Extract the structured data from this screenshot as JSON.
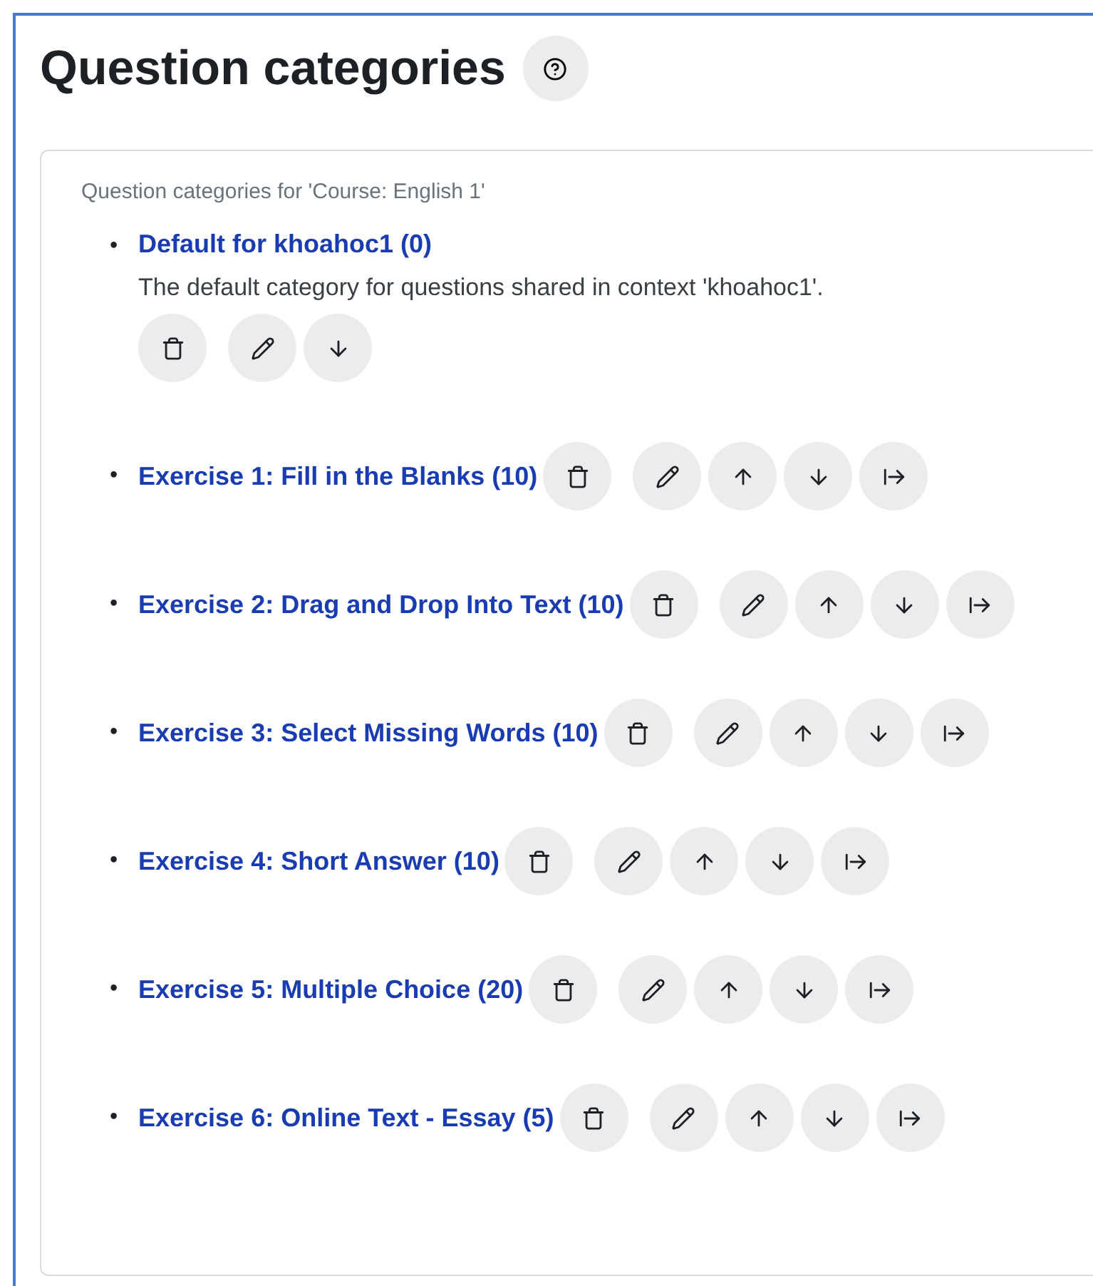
{
  "page": {
    "title": "Question categories"
  },
  "card": {
    "caption": "Question categories for 'Course: English 1'",
    "categories": [
      {
        "bullet": "•",
        "name": "Default for khoahoc1 (0)",
        "description": "The default category for questions shared in context 'khoahoc1'.",
        "actions": [
          {
            "kind": "delete"
          },
          {
            "kind": "edit"
          },
          {
            "kind": "down"
          }
        ]
      },
      {
        "bullet": "•",
        "name": "Exercise 1: Fill in the Blanks (10)",
        "actions": [
          {
            "kind": "delete"
          },
          {
            "kind": "edit"
          },
          {
            "kind": "up"
          },
          {
            "kind": "down"
          },
          {
            "kind": "move"
          }
        ]
      },
      {
        "bullet": "•",
        "name": "Exercise 2: Drag and Drop Into Text (10)",
        "actions": [
          {
            "kind": "delete"
          },
          {
            "kind": "edit"
          },
          {
            "kind": "up"
          },
          {
            "kind": "down"
          },
          {
            "kind": "move"
          }
        ]
      },
      {
        "bullet": "•",
        "name": "Exercise 3: Select Missing Words (10)",
        "actions": [
          {
            "kind": "delete"
          },
          {
            "kind": "edit"
          },
          {
            "kind": "up"
          },
          {
            "kind": "down"
          },
          {
            "kind": "move"
          }
        ]
      },
      {
        "bullet": "•",
        "name": "Exercise 4: Short Answer (10)",
        "actions": [
          {
            "kind": "delete"
          },
          {
            "kind": "edit"
          },
          {
            "kind": "up"
          },
          {
            "kind": "down"
          },
          {
            "kind": "move"
          }
        ]
      },
      {
        "bullet": "•",
        "name": "Exercise 5: Multiple Choice (20)",
        "actions": [
          {
            "kind": "delete"
          },
          {
            "kind": "edit"
          },
          {
            "kind": "up"
          },
          {
            "kind": "down"
          },
          {
            "kind": "move"
          }
        ]
      },
      {
        "bullet": "•",
        "name": "Exercise 6: Online Text - Essay (5)",
        "actions": [
          {
            "kind": "delete"
          },
          {
            "kind": "edit"
          },
          {
            "kind": "up"
          },
          {
            "kind": "down"
          },
          {
            "kind": "move"
          }
        ]
      }
    ]
  }
}
